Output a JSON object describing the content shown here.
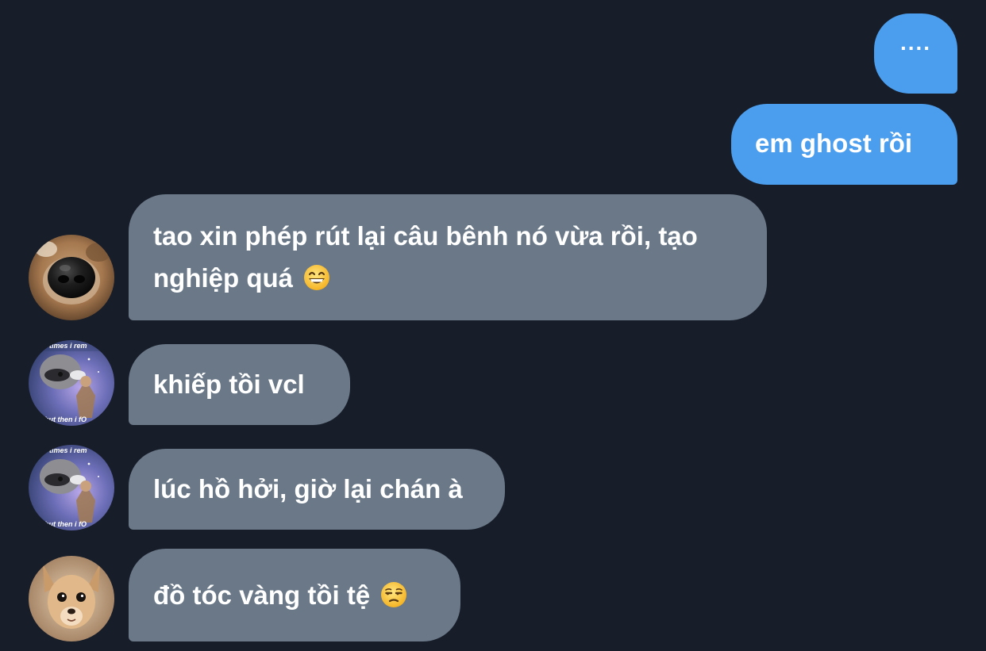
{
  "messages": {
    "out_1": {
      "text": "...."
    },
    "out_2": {
      "text": "em ghost rồi"
    },
    "in_1": {
      "text_line1": "tao xin phép rút lại câu bênh nó vừa rồi, tạo",
      "text_line2": "nghiệp quá",
      "emoji": "grinning-face-with-smiling-eyes-icon"
    },
    "in_2": {
      "text": "khiếp tồi vcl"
    },
    "in_3": {
      "text": "lúc hồ hởi, giờ lại chán à"
    },
    "in_4": {
      "text": "đồ tóc vàng tồi tệ",
      "emoji": "unamused-face-icon"
    }
  },
  "avatars": {
    "dog_nose": {
      "icon": "dog-nose-avatar"
    },
    "raccoon_meme": {
      "icon": "raccoon-meme-avatar",
      "caption_top": "times i rem",
      "caption_bottom": "but then i fO"
    },
    "chihuahua": {
      "icon": "chihuahua-avatar"
    }
  },
  "colors": {
    "background": "#171d29",
    "outgoing_bubble": "#4b9ded",
    "incoming_bubble": "#6a7888",
    "text": "#ffffff"
  }
}
